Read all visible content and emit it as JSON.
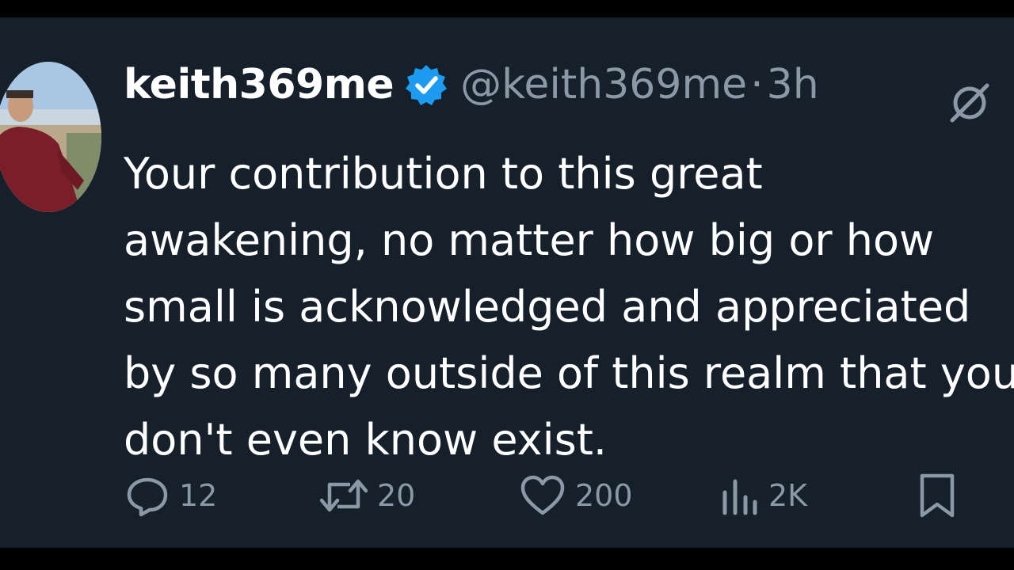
{
  "tweet": {
    "display_name": "keith369me",
    "handle": "@keith369me",
    "separator": "·",
    "time": "3h",
    "verified_icon": "verified-badge-icon",
    "lines": [
      "Your contribution to this great",
      "awakening, no matter how big or how",
      "small is acknowledged and appreciated",
      "by so many outside of this realm that you",
      "don't even know exist."
    ]
  },
  "actions": {
    "replies": {
      "icon": "reply-icon",
      "count": "12"
    },
    "reposts": {
      "icon": "repost-icon",
      "count": "20"
    },
    "likes": {
      "icon": "heart-icon",
      "count": "200"
    },
    "views": {
      "icon": "views-icon",
      "count": "2K"
    },
    "bookmark": {
      "icon": "bookmark-icon"
    }
  },
  "colors": {
    "background": "#15202b",
    "text": "#ffffff",
    "secondary_text": "#8b98a5",
    "verified_blue": "#1d9bf0"
  }
}
